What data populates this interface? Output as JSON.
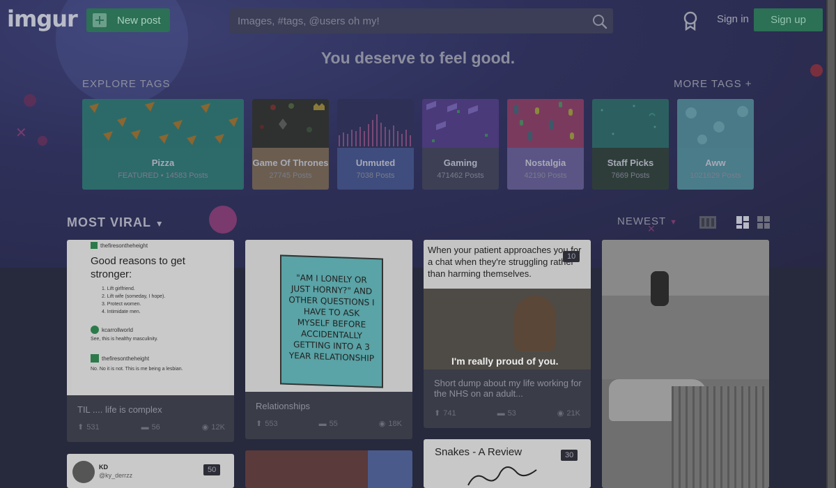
{
  "header": {
    "logo": "imgur",
    "new_post_label": "New post",
    "search_placeholder": "Images, #tags, @users oh my!",
    "sign_in_label": "Sign in",
    "sign_up_label": "Sign up"
  },
  "hero": {
    "tagline": "You deserve to feel good."
  },
  "explore": {
    "label": "EXPLORE TAGS",
    "more_label": "MORE TAGS +",
    "tags": [
      {
        "name": "Pizza",
        "count": "FEATURED • 14583 Posts",
        "color": "#2d6a6a"
      },
      {
        "name": "Game Of Thrones",
        "count": "27745 Posts",
        "color": "#6b5e50"
      },
      {
        "name": "Unmuted",
        "count": "7038 Posts",
        "color": "#3e4d7d"
      },
      {
        "name": "Gaming",
        "count": "471462 Posts",
        "color": "#3d3f55"
      },
      {
        "name": "Nostalgia",
        "count": "42190 Posts",
        "color": "#5a5585"
      },
      {
        "name": "Staff Picks",
        "count": "7669 Posts",
        "color": "#2e3d3a"
      },
      {
        "name": "Aww",
        "count": "1021629 Posts",
        "color": "#4a7c8a"
      }
    ]
  },
  "feed": {
    "section_label": "MOST VIRAL",
    "sort_label": "NEWEST",
    "posts": [
      {
        "title": "TIL .... life is complex",
        "ups": "531",
        "comments": "56",
        "views": "12K",
        "tweet": {
          "user1": "thefiresontheheight",
          "heading": "Good reasons to get stronger:",
          "items": [
            "Lift girlfriend.",
            "Lift wife (someday, I hope).",
            "Protect women.",
            "Intimidate men."
          ],
          "user2": "kcarrollworld",
          "reply2": "See, this is healthy masculinity.",
          "user3": "thefiresontheheight",
          "reply3": "No. No it is not. This is me being a lesbian."
        }
      },
      {
        "title": "Relationships",
        "ups": "553",
        "comments": "55",
        "views": "18K",
        "book_text": "\"AM I LONELY OR JUST HORNY?\" AND OTHER QUESTIONS I HAVE TO ASK MYSELF BEFORE ACCIDENTALLY GETTING INTO A 3 YEAR RELATIONSHIP"
      },
      {
        "title": "Short dump about my life working for the NHS on an adult...",
        "ups": "741",
        "comments": "53",
        "views": "21K",
        "badge": "10",
        "caption_top": "When your patient approaches you for a chat when they're struggling rather than harming themselves.",
        "caption_bottom": "I'm really proud of you."
      },
      {
        "title": "",
        "ups": "",
        "comments": "",
        "views": ""
      },
      {
        "user_name": "KD",
        "user_handle": "@ky_derrzz",
        "badge": "50"
      },
      {
        "title": "Snakes - A Review",
        "badge": "30"
      }
    ]
  }
}
